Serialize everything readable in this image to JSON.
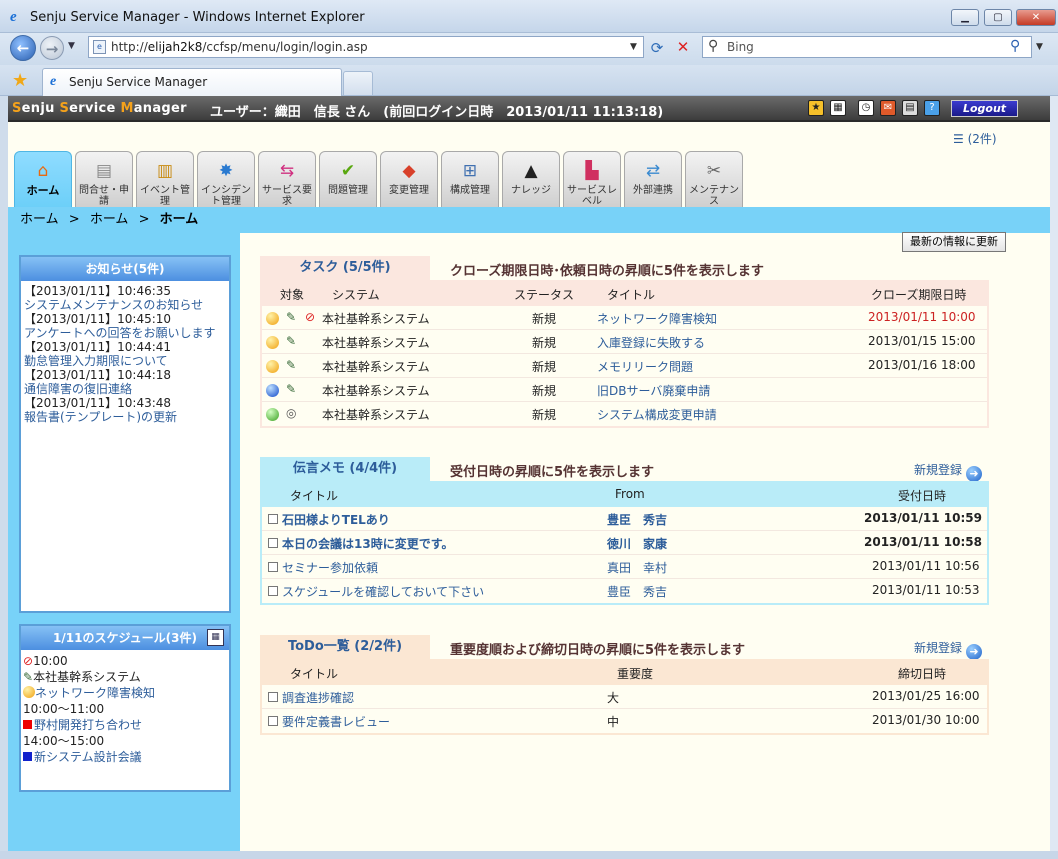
{
  "browser": {
    "window_title": "Senju Service Manager - Windows Internet Explorer",
    "url_prefix": "http://",
    "url_domain": "elijah2k8",
    "url_path": "/ccfsp/menu/login/login.asp",
    "search_placeholder": "Bing",
    "tab_title": "Senju Service Manager"
  },
  "header": {
    "brand_s1": "S",
    "brand_r1": "enju ",
    "brand_s2": "S",
    "brand_r2": "ervice ",
    "brand_s3": "M",
    "brand_r3": "anager",
    "user_line": "ユーザー：織田　信長 さん　(前回ログイン日時　2013/01/11 11:13:18)",
    "logout_label": "Logout",
    "unread_count": "(2件)"
  },
  "tabs": [
    {
      "label": "ホーム",
      "icon": "house-icon"
    },
    {
      "label": "問合せ・申請",
      "icon": "document-icon"
    },
    {
      "label": "イベント管理",
      "icon": "event-icon"
    },
    {
      "label": "インシデント管理",
      "icon": "car-icon"
    },
    {
      "label": "サービス要求",
      "icon": "signpost-icon"
    },
    {
      "label": "問題管理",
      "icon": "checkmark-icon"
    },
    {
      "label": "変更管理",
      "icon": "cubes-icon"
    },
    {
      "label": "構成管理",
      "icon": "network-icon"
    },
    {
      "label": "ナレッジ",
      "icon": "graduation-cap-icon"
    },
    {
      "label": "サービスレベル",
      "icon": "chart-icon"
    },
    {
      "label": "外部連携",
      "icon": "link-icon"
    },
    {
      "label": "メンテナンス",
      "icon": "tools-icon"
    }
  ],
  "breadcrumb": {
    "c1": "ホーム",
    "c2": "ホーム",
    "c3": "ホーム",
    "sep": ">"
  },
  "news": {
    "title": "お知らせ(5件)",
    "items": [
      {
        "date": "【2013/01/11】10:46:35",
        "text": "システムメンテナンスのお知らせ"
      },
      {
        "date": "【2013/01/11】10:45:10",
        "text": "アンケートへの回答をお願いします"
      },
      {
        "date": "【2013/01/11】10:44:41",
        "text": "勤怠管理入力期限について"
      },
      {
        "date": "【2013/01/11】10:44:18",
        "text": "通信障害の復旧連絡"
      },
      {
        "date": "【2013/01/11】10:43:48",
        "text": "報告書(テンプレート)の更新"
      }
    ]
  },
  "schedule": {
    "title": "1/11のスケジュール(3件)",
    "e1_time": "10:00",
    "e1_system": "本社基幹系システム",
    "e1_title": "ネットワーク障害検知",
    "e2_time": "10:00～11:00",
    "e2_title": "野村開発打ち合わせ",
    "e3_time": "14:00～15:00",
    "e3_title": "新システム設計会議"
  },
  "refresh_button": "最新の情報に更新",
  "tasks": {
    "tab": "タスク (5/5件)",
    "desc": "クローズ期限日時･依頼日時の昇順に5件を表示します",
    "headers": {
      "target": "対象",
      "system": "システム",
      "status": "ステータス",
      "title": "タイトル",
      "deadline": "クローズ期限日時"
    },
    "rows": [
      {
        "system": "本社基幹系システム",
        "status": "新規",
        "title": "ネットワーク障害検知",
        "deadline": "2013/01/11 10:00"
      },
      {
        "system": "本社基幹系システム",
        "status": "新規",
        "title": "入庫登録に失敗する",
        "deadline": "2013/01/15 15:00"
      },
      {
        "system": "本社基幹系システム",
        "status": "新規",
        "title": "メモリリーク問題",
        "deadline": "2013/01/16 18:00"
      },
      {
        "system": "本社基幹系システム",
        "status": "新規",
        "title": "旧DBサーバ廃棄申請",
        "deadline": ""
      },
      {
        "system": "本社基幹系システム",
        "status": "新規",
        "title": "システム構成変更申請",
        "deadline": ""
      }
    ]
  },
  "memo": {
    "tab": "伝言メモ (4/4件)",
    "desc": "受付日時の昇順に5件を表示します",
    "new_label": "新規登録",
    "headers": {
      "title": "タイトル",
      "from": "From",
      "date": "受付日時"
    },
    "rows": [
      {
        "title": "石田様よりTELあり",
        "from": "豊臣　秀吉",
        "date": "2013/01/11 10:59"
      },
      {
        "title": "本日の会議は13時に変更です。",
        "from": "徳川　家康",
        "date": "2013/01/11 10:58"
      },
      {
        "title": "セミナー参加依頼",
        "from": "真田　幸村",
        "date": "2013/01/11 10:56"
      },
      {
        "title": "スケジュールを確認しておいて下さい",
        "from": "豊臣　秀吉",
        "date": "2013/01/11 10:53"
      }
    ]
  },
  "todo": {
    "tab": "ToDo一覧 (2/2件)",
    "desc": "重要度順および締切日時の昇順に5件を表示します",
    "new_label": "新規登録",
    "headers": {
      "title": "タイトル",
      "priority": "重要度",
      "deadline": "締切日時"
    },
    "rows": [
      {
        "title": "調査進捗確認",
        "priority": "大",
        "deadline": "2013/01/25 16:00"
      },
      {
        "title": "要件定義書レビュー",
        "priority": "中",
        "deadline": "2013/01/30 10:00"
      }
    ]
  },
  "colors": {
    "accent": "#78d2f8",
    "link": "#2d5d9a",
    "overdue": "#cc2222"
  }
}
